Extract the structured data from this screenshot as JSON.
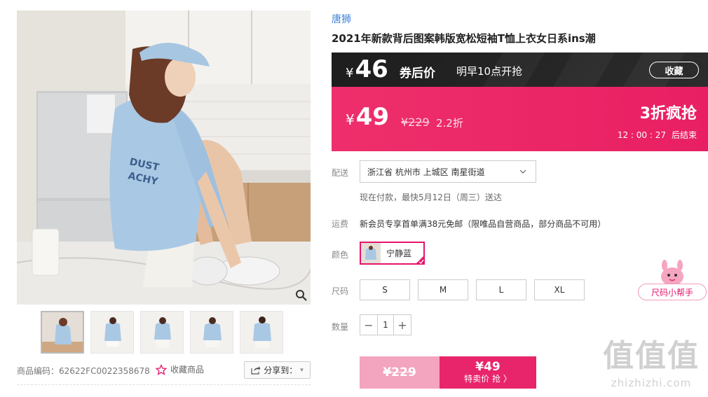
{
  "brand": "唐狮",
  "product_title": "2021年新款背后图案韩版宽松短袖T恤上衣女日系ins潮",
  "coupon_banner": {
    "currency": "¥",
    "price": "46",
    "label": "券后价",
    "open_time": "明早10点开抢",
    "collect_label": "收藏"
  },
  "sale_banner": {
    "currency": "¥",
    "price": "49",
    "original_price": "¥229",
    "discount": "2.2折",
    "headline": "3折疯抢",
    "countdown": "12 : 00 : 27",
    "countdown_suffix": "后结束"
  },
  "shipping": {
    "label": "配送",
    "address": "浙江省 杭州市 上城区 南星街道",
    "delivery_note": "现在付款，最快5月12日（周三）送达"
  },
  "freight": {
    "label": "运费",
    "text": "新会员专享首单满38元免邮（限唯品自营商品，部分商品不可用）"
  },
  "color": {
    "label": "颜色",
    "selected": "宁静蓝"
  },
  "size": {
    "label": "尺码",
    "options": [
      "S",
      "M",
      "L",
      "XL"
    ],
    "helper": "尺码小帮手"
  },
  "quantity": {
    "label": "数量",
    "value": "1",
    "minus": "−",
    "plus": "+"
  },
  "buy": {
    "original_price": "¥229",
    "sale_price": "¥49",
    "cta": "特卖价 抢 〉"
  },
  "gallery": {
    "sku_code": "商品编码：62622FC0022358678",
    "favorite_label": "收藏商品",
    "share_label": "分享到：",
    "share_caret": "▾",
    "thumbnails": [
      "thumb-1",
      "thumb-2",
      "thumb-3",
      "thumb-4",
      "thumb-5"
    ]
  },
  "watermark": {
    "glyphs": "值值值",
    "site": "zhizhizhi.com"
  },
  "colors": {
    "accent_pink": "#e91f63",
    "dark_banner": "#1d1d1d",
    "brand_blue": "#3d7fd8"
  }
}
